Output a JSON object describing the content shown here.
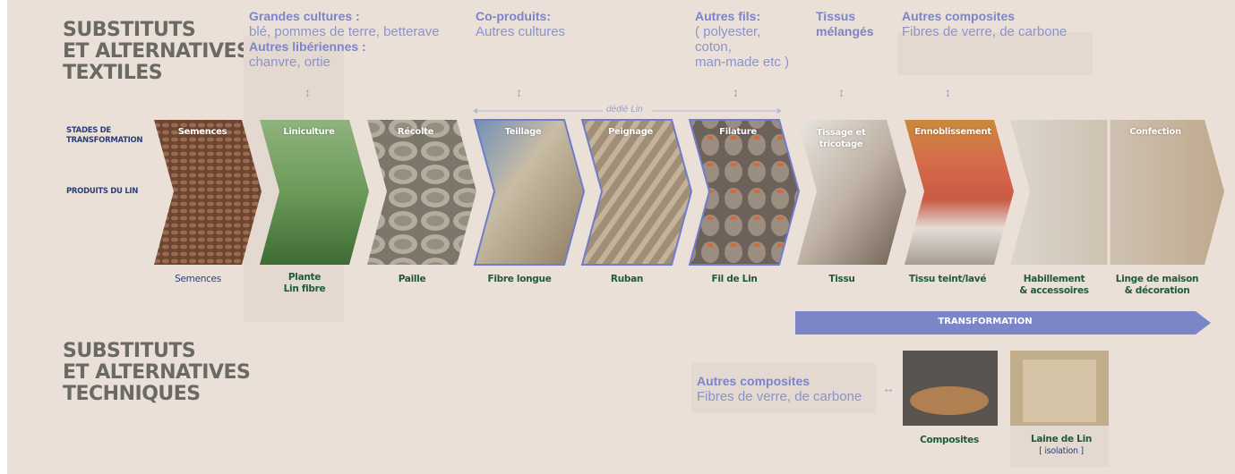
{
  "titles": {
    "textiles": [
      "SUBSTITUTS",
      "ET ALTERNATIVES",
      "TEXTILES"
    ],
    "techniques": [
      "SUBSTITUTS",
      "ET ALTERNATIVES",
      "TECHNIQUES"
    ]
  },
  "side_labels": {
    "stages": [
      "STADES DE",
      "TRANSFORMATION"
    ],
    "products": "PRODUITS DU LIN"
  },
  "alternatives": {
    "grandes_cultures_title": "Grandes cultures :",
    "grandes_cultures_text": "blé, pommes de terre, betterave",
    "autres_liberiennes_title": "Autres libériennes :",
    "autres_liberiennes_text": "chanvre, ortie",
    "coproduits_title": "Co-produits:",
    "coproduits_text": "Autres cultures",
    "autres_fils_title": "Autres fils:",
    "autres_fils_text": [
      "( polyester,",
      "coton,",
      "man-made etc )"
    ],
    "tissus_title": [
      "Tissus",
      "mélangés"
    ],
    "composites_title": "Autres composites",
    "composites_text": "Fibres de verre, de carbone"
  },
  "dedie_label": "dédié Lin",
  "arrow_symbol": "↕",
  "arrow_lr_symbol": "↔",
  "stages": [
    {
      "name": "Semences",
      "product": "Semences",
      "product2": ""
    },
    {
      "name": "Liniculture",
      "product": "Plante",
      "product2": "Lin fibre"
    },
    {
      "name": "Récolte",
      "product": "Paille",
      "product2": ""
    },
    {
      "name": "Teillage",
      "product": "Fibre longue",
      "product2": ""
    },
    {
      "name": "Peignage",
      "product": "Ruban",
      "product2": ""
    },
    {
      "name": "Filature",
      "product": "Fil de Lin",
      "product2": ""
    },
    {
      "name": "Tissage et tricotage",
      "product": "Tissu",
      "product2": ""
    },
    {
      "name": "Ennoblissement",
      "product": "Tissu teint/lavé",
      "product2": ""
    },
    {
      "name": "Confection",
      "product": "Habillement",
      "product2": "& accessoires"
    },
    {
      "name": "",
      "product": "Linge de maison",
      "product2": "& décoration"
    }
  ],
  "transformation_label": "TRANSFORMATION",
  "techniques": {
    "composites_title": "Autres composites",
    "composites_text": "Fibres de verre, de carbone",
    "products": [
      {
        "label": "Composites",
        "sub": ""
      },
      {
        "label": "Laine de Lin",
        "sub": "[ isolation ]"
      }
    ]
  },
  "colors": {
    "background": "#eae0d7",
    "title_gray": "#6b6964",
    "accent_blue": "#7b85c7",
    "product_green": "#1f5a3e",
    "dedie_border": "#6f7ccc"
  }
}
